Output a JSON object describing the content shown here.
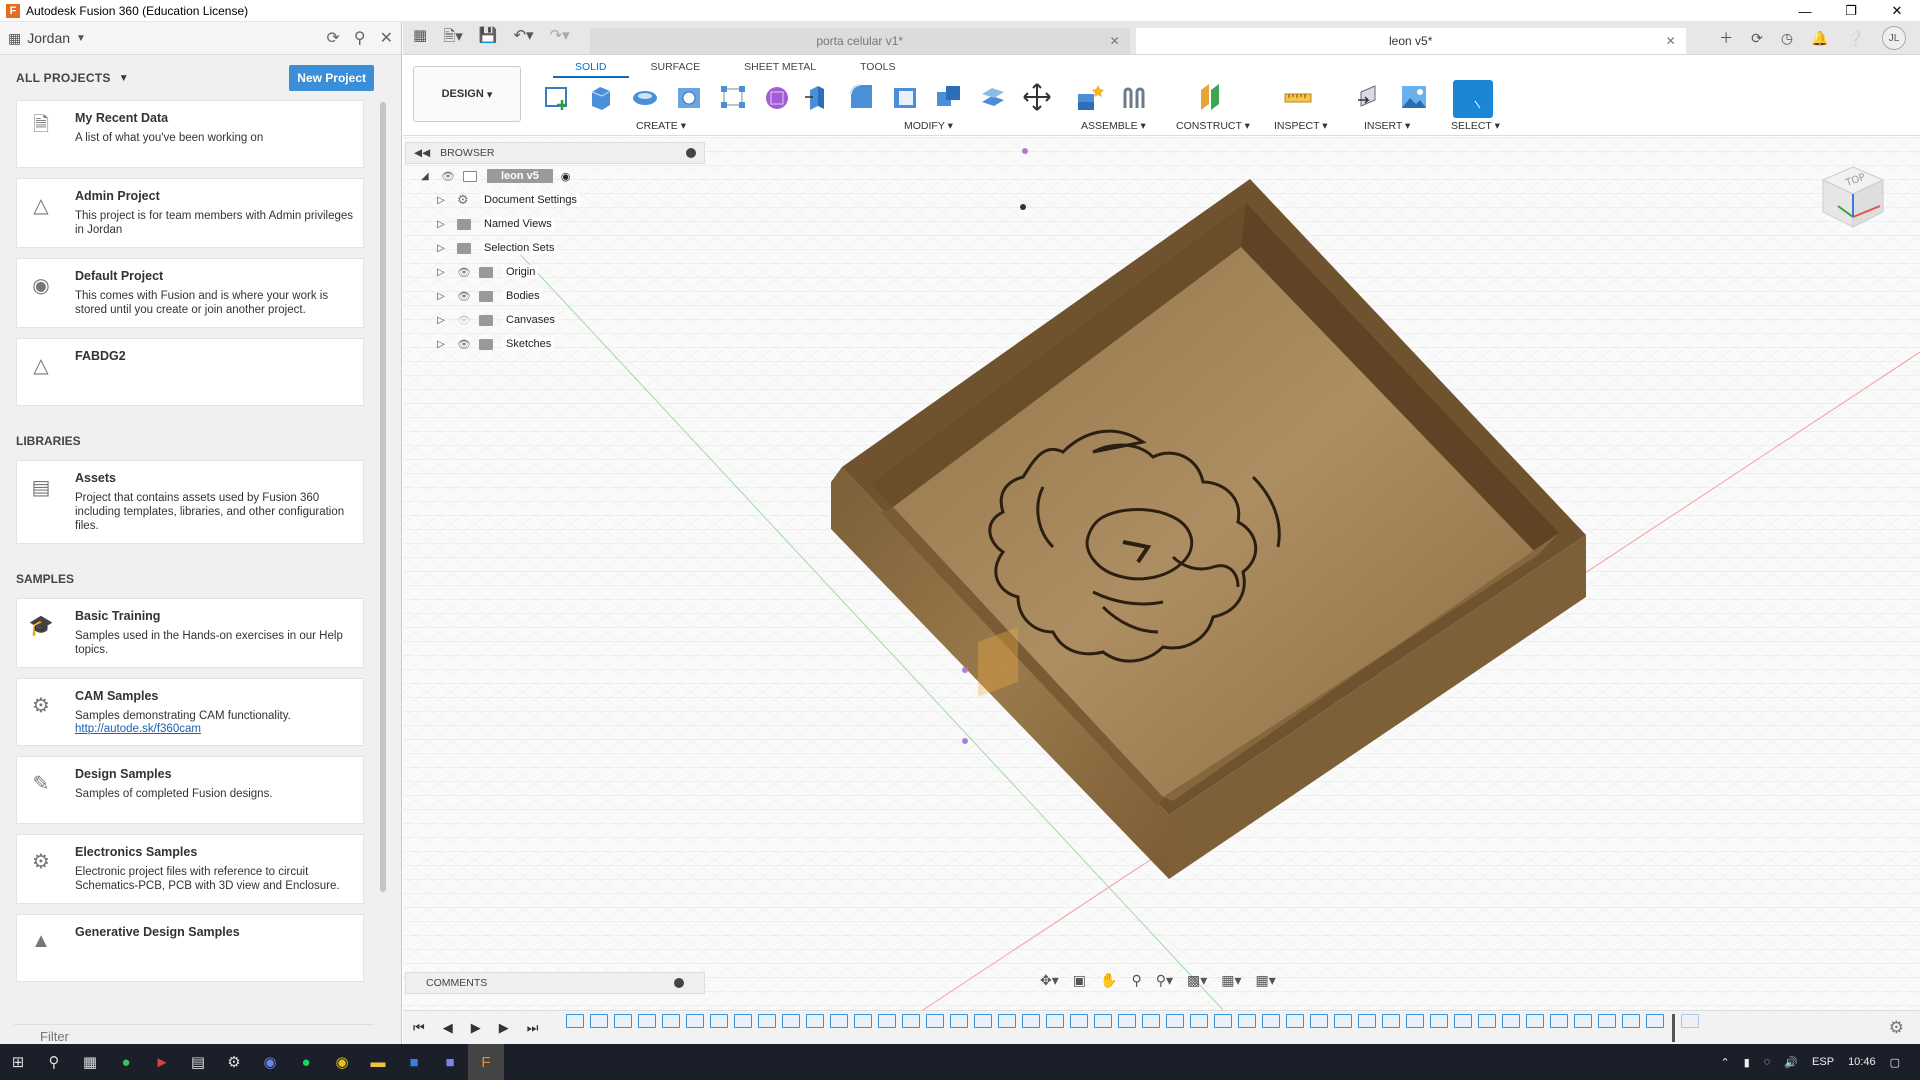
{
  "window": {
    "title": "Autodesk Fusion 360 (Education License)",
    "app_icon": "F"
  },
  "left_panel": {
    "user": "Jordan",
    "all_projects": "ALL PROJECTS",
    "new_project": "New Project",
    "projects": [
      {
        "title": "My Recent Data",
        "desc": "A list of what you've been working on",
        "icon": "recent-data-icon"
      },
      {
        "title": "Admin Project",
        "desc": "This project is for team members with Admin privileges in Jordan",
        "icon": "project-icon"
      },
      {
        "title": "Default Project",
        "desc": "This comes with Fusion and is where your work is stored until you create or join another project.",
        "icon": "default-project-icon"
      },
      {
        "title": "FABDG2",
        "desc": "",
        "icon": "project-icon"
      }
    ],
    "libraries_label": "LIBRARIES",
    "libraries": [
      {
        "title": "Assets",
        "desc": "Project that contains assets used by Fusion 360 including templates, libraries, and other configuration files."
      }
    ],
    "samples_label": "SAMPLES",
    "samples": [
      {
        "title": "Basic Training",
        "desc": "Samples used in the Hands-on exercises in our Help topics.",
        "link": ""
      },
      {
        "title": "CAM Samples",
        "desc": "Samples demonstrating CAM functionality.",
        "link": "http://autode.sk/f360cam"
      },
      {
        "title": "Design Samples",
        "desc": "Samples of completed Fusion designs.",
        "link": ""
      },
      {
        "title": "Electronics Samples",
        "desc": "Electronic project files with reference to circuit Schematics-PCB, PCB with 3D view and Enclosure.",
        "link": ""
      },
      {
        "title": "Generative Design Samples",
        "desc": "",
        "link": ""
      }
    ],
    "filter_placeholder": "Filter"
  },
  "doc_tabs": [
    {
      "label": "porta celular v1*",
      "active": false
    },
    {
      "label": "leon v5*",
      "active": true
    }
  ],
  "toolbar": {
    "tabs": [
      "SOLID",
      "SURFACE",
      "SHEET METAL",
      "TOOLS"
    ],
    "active_tab": "SOLID",
    "workspace": "DESIGN",
    "groups": [
      "CREATE",
      "MODIFY",
      "ASSEMBLE",
      "CONSTRUCT",
      "INSPECT",
      "INSERT",
      "SELECT"
    ]
  },
  "browser": {
    "title": "BROWSER",
    "root": "leon v5",
    "nodes": [
      "Document Settings",
      "Named Views",
      "Selection Sets",
      "Origin",
      "Bodies",
      "Canvases",
      "Sketches"
    ]
  },
  "comments": {
    "title": "COMMENTS"
  },
  "nav_cube": {
    "face": "TOP"
  },
  "tray": {
    "lang": "ESP",
    "time": "10:46"
  },
  "colors": {
    "accent": "#0a6fc4",
    "wood": "#8a6a3e",
    "new_project_btn": "#3b8ed8"
  }
}
